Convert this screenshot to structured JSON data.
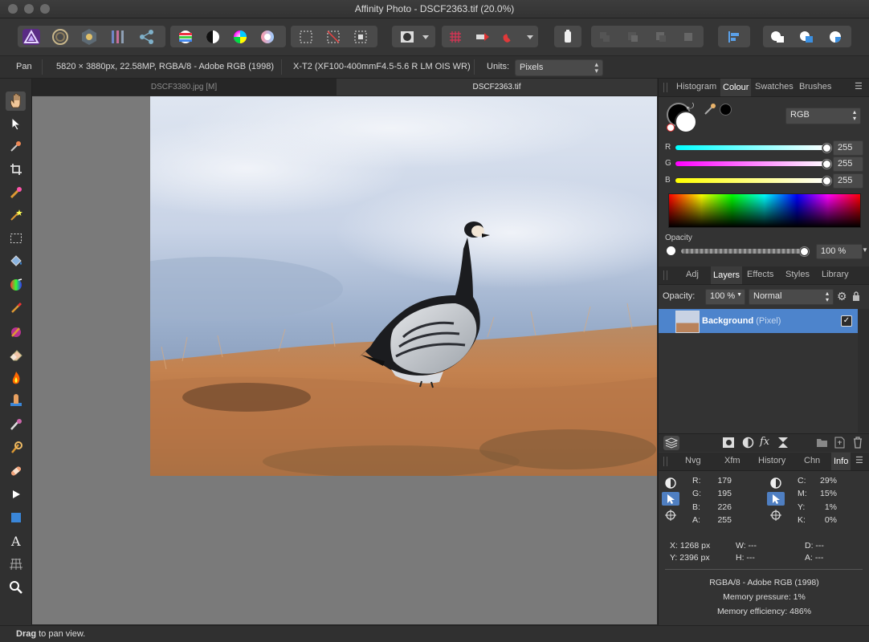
{
  "window": {
    "title": "Affinity Photo - DSCF2363.tif (20.0%)"
  },
  "context_bar": {
    "tool": "Pan",
    "image_info": "5820 × 3880px, 22.58MP, RGBA/8 - Adobe RGB (1998)",
    "lens": "X-T2 (XF100-400mmF4.5-5.6 R LM OIS WR)",
    "units_label": "Units:",
    "units_value": "Pixels"
  },
  "doc_tabs": [
    {
      "label": "DSCF3380.jpg [M]",
      "active": false
    },
    {
      "label": "DSCF2363.tif",
      "active": true
    }
  ],
  "status": {
    "bold": "Drag",
    "rest": " to pan view."
  },
  "colour_panel": {
    "tabs": [
      "Histogram",
      "Colour",
      "Swatches",
      "Brushes"
    ],
    "active_tab": "Colour",
    "model": "RGB",
    "r_label": "R",
    "r_value": "255",
    "g_label": "G",
    "g_value": "255",
    "b_label": "B",
    "b_value": "255",
    "opacity_label": "Opacity",
    "opacity_value": "100 %"
  },
  "layers_panel": {
    "tabs": [
      "Adj",
      "Layers",
      "Effects",
      "Styles",
      "Library"
    ],
    "active_tab": "Layers",
    "opacity_label": "Opacity:",
    "opacity_value": "100 %",
    "blend_mode": "Normal",
    "layer_name": "Background",
    "layer_type": "(Pixel)"
  },
  "info_panel": {
    "tabs": [
      "Nvg",
      "Xfm",
      "History",
      "Chn",
      "Info"
    ],
    "active_tab": "Info",
    "rgb": {
      "R": "179",
      "G": "195",
      "B": "226",
      "A": "255"
    },
    "rgb_labels": {
      "R": "R:",
      "G": "G:",
      "B": "B:",
      "A": "A:"
    },
    "cmyk": {
      "C": "29%",
      "M": "15%",
      "Y": "1%",
      "K": "0%"
    },
    "cmyk_labels": {
      "C": "C:",
      "M": "M:",
      "Y": "Y:",
      "K": "K:"
    },
    "x": "X: 1268 px",
    "y": "Y: 2396 px",
    "w": "W: ---",
    "h": "H: ---",
    "d": "D: ---",
    "a": "A: ---",
    "format": "RGBA/8 - Adobe RGB (1998)",
    "memory_pressure": "Memory pressure: 1%",
    "memory_efficiency": "Memory efficiency: 486%"
  },
  "colors": {
    "accent": "#4f7fc2",
    "selected_layer": "#4d84cc"
  }
}
